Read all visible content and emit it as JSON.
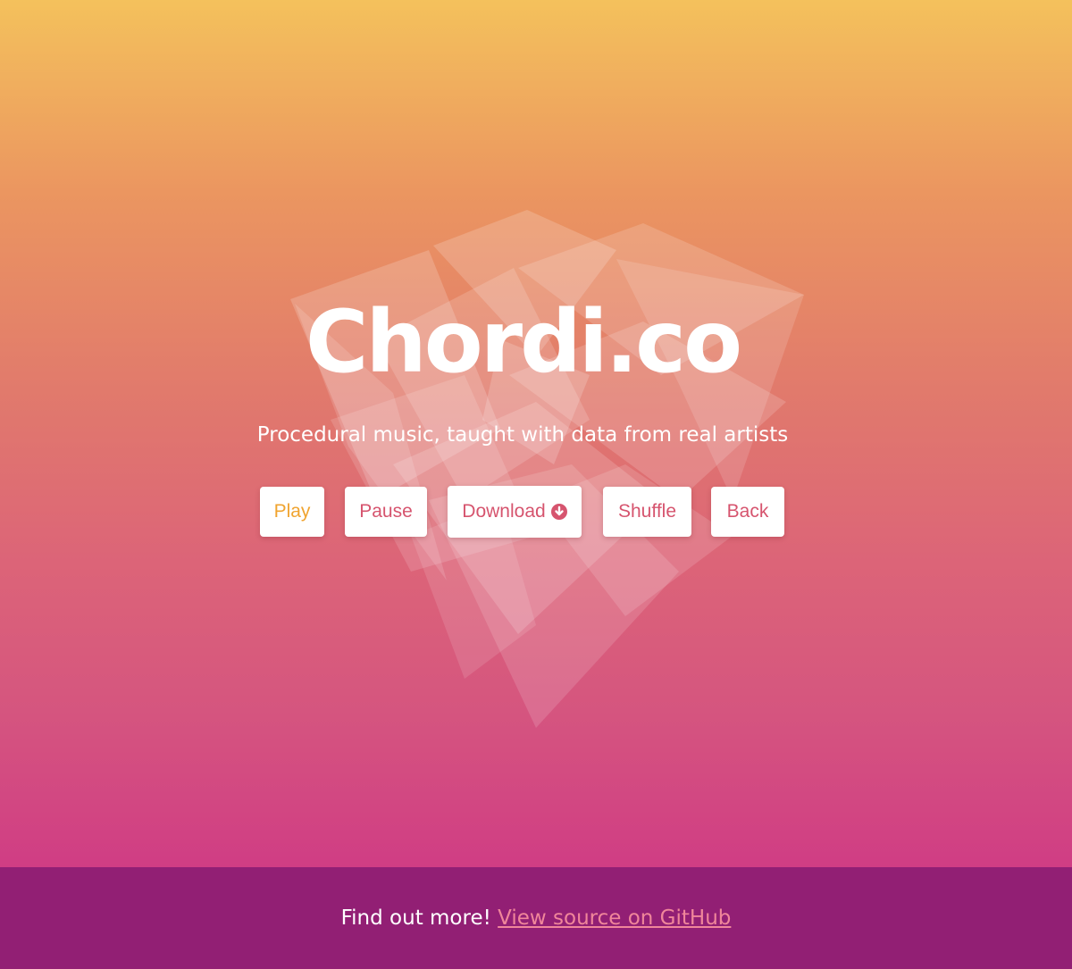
{
  "hero": {
    "title": "Chordi.co",
    "subtitle": "Procedural music, taught with data from real artists"
  },
  "controls": {
    "play_label": "Play",
    "pause_label": "Pause",
    "download_label": "Download",
    "download_icon": "download-circle-icon",
    "shuffle_label": "Shuffle",
    "back_label": "Back"
  },
  "footer": {
    "text": "Find out more!",
    "link_text": "View source on GitHub"
  },
  "colors": {
    "gradient_top": "#f4c15c",
    "gradient_bottom": "#d03d84",
    "footer_bg": "#921f74",
    "button_text": "#d6546e",
    "play_text": "#f0a430",
    "link": "#f0869a"
  }
}
